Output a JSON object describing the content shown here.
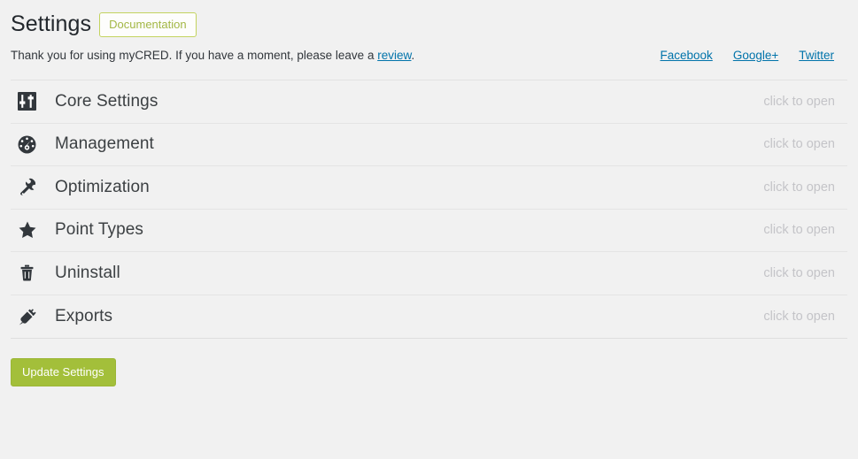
{
  "header": {
    "title": "Settings",
    "documentation_label": "Documentation"
  },
  "notice": {
    "text_before": "Thank you for using myCRED. If you have a moment, please leave a ",
    "link_label": "review",
    "text_after": "."
  },
  "social_links": [
    {
      "label": "Facebook",
      "name": "facebook-link"
    },
    {
      "label": "Google+",
      "name": "googleplus-link"
    },
    {
      "label": "Twitter",
      "name": "twitter-link"
    }
  ],
  "accordion": {
    "hint_label": "click to open",
    "rows": [
      {
        "label": "Core Settings",
        "icon": "sliders-icon",
        "hint": "click to open"
      },
      {
        "label": "Management",
        "icon": "dashboard-gauge-icon",
        "hint": "click to open"
      },
      {
        "label": "Optimization",
        "icon": "wrench-icon",
        "hint": "click to open"
      },
      {
        "label": "Point Types",
        "icon": "star-icon",
        "hint": "click to open"
      },
      {
        "label": "Uninstall",
        "icon": "trash-icon",
        "hint": "click to open"
      },
      {
        "label": "Exports",
        "icon": "plug-icon",
        "hint": "click to open"
      }
    ]
  },
  "submit": {
    "label": "Update Settings"
  },
  "colors": {
    "accent_green": "#a3bf3a",
    "doc_border_green": "#c3d35f",
    "doc_text_green": "#a3b745",
    "link_blue": "#0073aa",
    "page_background": "#f1f1f1",
    "hint_gray": "#c4c4c8",
    "title_dark": "#23282d"
  }
}
